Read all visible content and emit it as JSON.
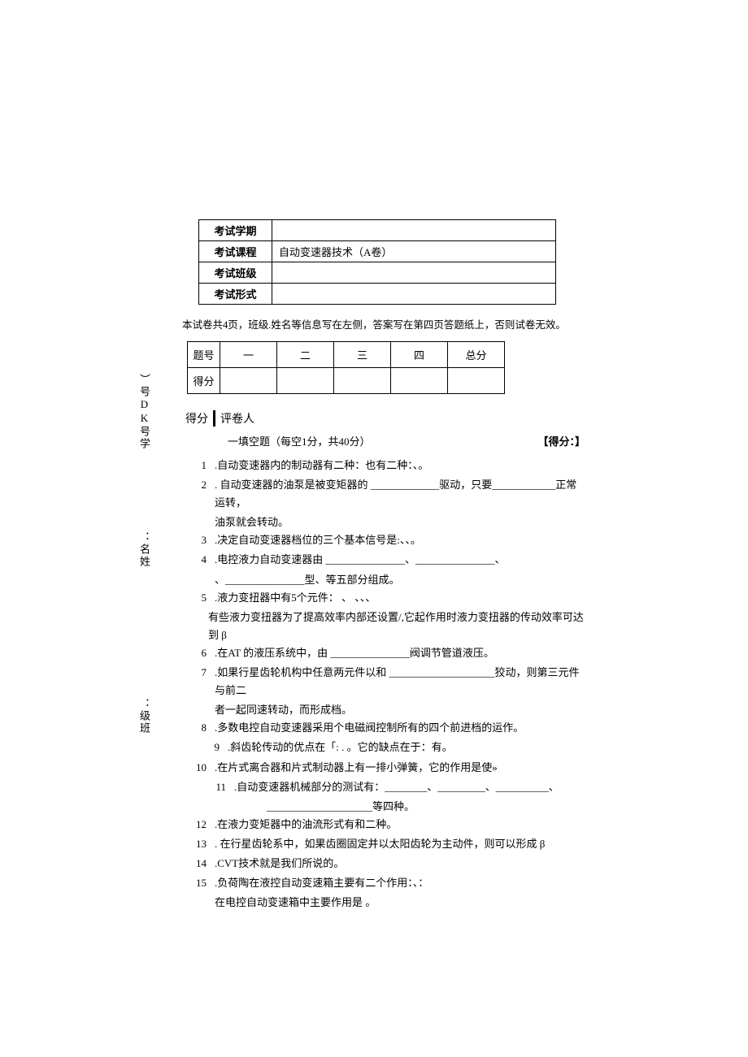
{
  "sidebar": {
    "item1": "）号DK号学",
    "item2": "：名姓",
    "item3": "：级班"
  },
  "info_table": {
    "rows": [
      {
        "label": "考试学期",
        "value": ""
      },
      {
        "label": "考试课程",
        "value": "自动变速器技术（A卷）"
      },
      {
        "label": "考试班级",
        "value": ""
      },
      {
        "label": "考试形式",
        "value": ""
      }
    ]
  },
  "instruction": "本试卷共4页，班级.姓名等信息写在左侧，答案写在第四页答题纸上，否则试卷无效。",
  "score_table": {
    "row1_label": "题号",
    "cols": [
      "一",
      "二",
      "三",
      "四",
      "总分"
    ],
    "row2_label": "得分"
  },
  "section_header": {
    "left": "得分",
    "right": "评卷人"
  },
  "section1": {
    "title": "一填空题（每空1分，共40分）",
    "score_label": "【得分：】"
  },
  "questions": [
    {
      "num": "1",
      "text": ".自动变速器内的制动器有二种：也有二种：、。"
    },
    {
      "num": "2",
      "text": ". 自动变速器的油泵是被变矩器的 _____________驱动，只要____________正常运转，",
      "cont": "油泵就会转动。"
    },
    {
      "num": "3",
      "text": ".决定自动变速器档位的三个基本信号是:、、。"
    },
    {
      "num": "4",
      "text": ".电控液力自动变速器由 _______________、_______________、",
      "cont": "、_______________型、等五部分组成。"
    },
    {
      "num": "5",
      "text": ".液力变扭器中有5个元件：        、        、、、",
      "cont": "有些液力变扭器为了提高效率内部还设置/,它起作用时液力变扭器的传动效率可达到 β"
    },
    {
      "num": "6",
      "text": ".在AT 的液压系统中，由 _______________阀调节管道液压。"
    },
    {
      "num": "7",
      "text": ".如果行星齿轮机构中任意两元件以和 ____________________狡动，则第三元件与前二",
      "cont": "者一起同速转动，而形成档。"
    },
    {
      "num": "8",
      "text": ".多数电控自动变速器采用个电磁阀控制所有的四个前进档的运作。"
    },
    {
      "num": "9",
      "text": ".斜齿轮传动的优点在「: . 。它的缺点在于：有。"
    },
    {
      "num": "10",
      "text": ".在片式离合器和片式制动器上有一排小弹簧，它的作用是使»"
    },
    {
      "num": "11",
      "text": ".自动变速器机械部分的测试有：________、_________、__________、",
      "cont": "____________________等四种。"
    },
    {
      "num": "12",
      "text": ".在液力变矩器中的油流形式有和二种。"
    },
    {
      "num": "13",
      "text": ". 在行星齿轮系中，如果齿圈固定并以太阳齿轮为主动件，则可以形成 β"
    },
    {
      "num": "14",
      "text": ".CVT技术就是我们所说的。"
    },
    {
      "num": "15",
      "text": ".负荷陶在液控自动变速箱主要有二个作用：、：",
      "cont": "在电控自动变速箱中主要作用是                                    。"
    }
  ]
}
